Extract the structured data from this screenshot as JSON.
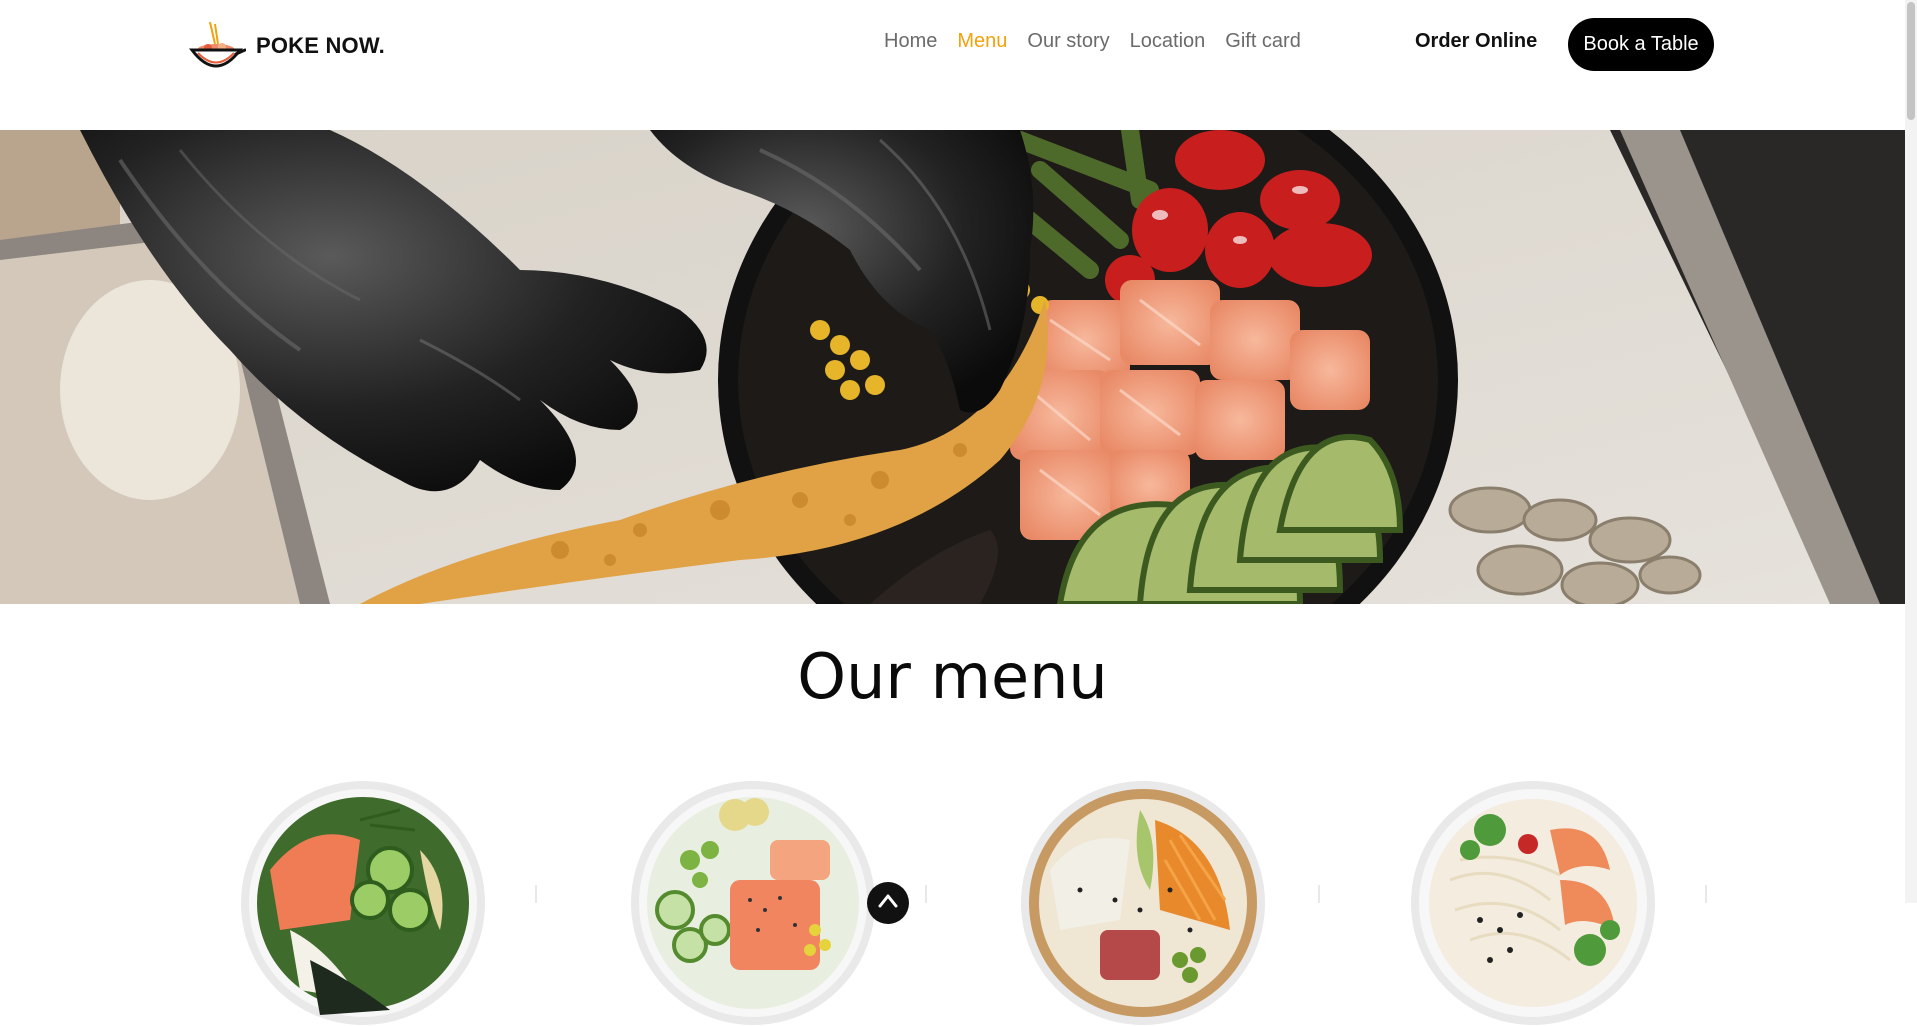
{
  "brand": {
    "name": "POKE NOW.",
    "logo_icon": "poke-bowl-logo-icon"
  },
  "nav": {
    "items": [
      {
        "label": "Home",
        "active": false
      },
      {
        "label": "Menu",
        "active": true
      },
      {
        "label": "Our story",
        "active": false
      },
      {
        "label": "Location",
        "active": false
      },
      {
        "label": "Gift card",
        "active": false
      }
    ],
    "active_color": "#f2a20c"
  },
  "header_actions": {
    "order_online_label": "Order Online",
    "book_table_label": "Book a Table"
  },
  "hero": {
    "image_description_icon": "poke-bowl-hero-image"
  },
  "menu": {
    "title": "Our menu",
    "items": [
      {
        "icon": "salmon-cucumber-bowl-image"
      },
      {
        "icon": "salmon-edamame-bowl-image"
      },
      {
        "icon": "tuna-carrot-bowl-image"
      },
      {
        "icon": "shrimp-noodle-bowl-image"
      }
    ]
  },
  "scroll_top_icon": "scroll-up-icon"
}
